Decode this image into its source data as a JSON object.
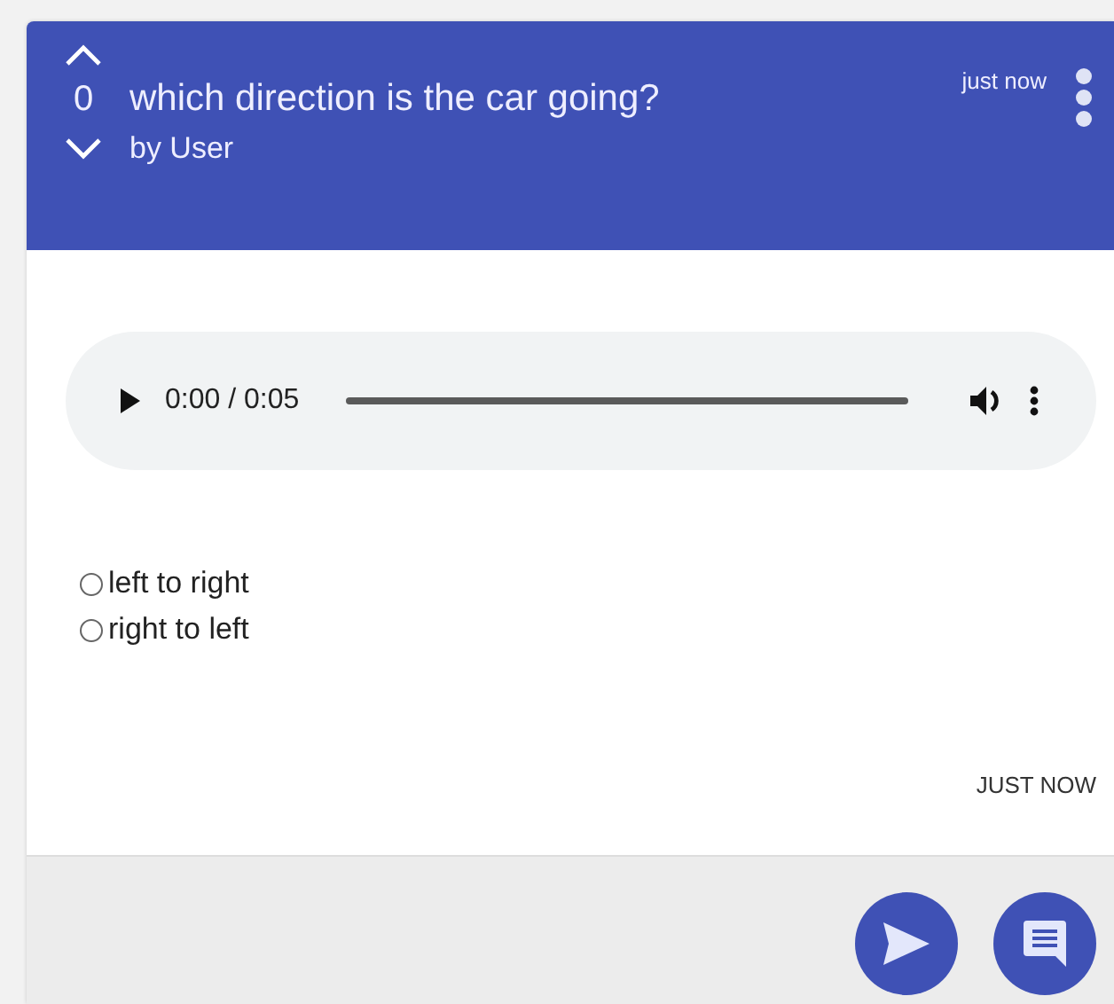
{
  "post": {
    "score": "0",
    "title": "which direction is the car going?",
    "author": "by User",
    "time": "just now"
  },
  "audio": {
    "time": "0:00 / 0:05"
  },
  "options": [
    {
      "label": "left to right",
      "selected": false
    },
    {
      "label": "right to left",
      "selected": false
    }
  ],
  "timestamp": "JUST NOW"
}
